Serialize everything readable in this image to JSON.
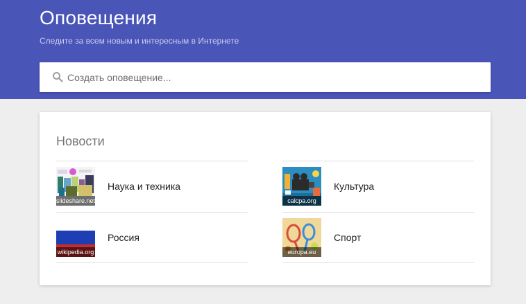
{
  "header": {
    "title": "Оповещения",
    "subtitle": "Следите за всем новым и интересным в Интернете"
  },
  "search": {
    "placeholder": "Создать оповещение..."
  },
  "news": {
    "title": "Новости",
    "topics": [
      {
        "label": "Наука и техника",
        "source": "slideshare.net",
        "icon": "science-thumbnail"
      },
      {
        "label": "Культура",
        "source": "calcpa.org",
        "icon": "culture-thumbnail"
      },
      {
        "label": "Россия",
        "source": "wikipedia.org",
        "icon": "russia-flag-thumbnail"
      },
      {
        "label": "Спорт",
        "source": "europa.eu",
        "icon": "sport-thumbnail"
      }
    ]
  },
  "colors": {
    "header_bg": "#4a55b8",
    "page_bg": "#eeeeee",
    "card_bg": "#ffffff"
  }
}
